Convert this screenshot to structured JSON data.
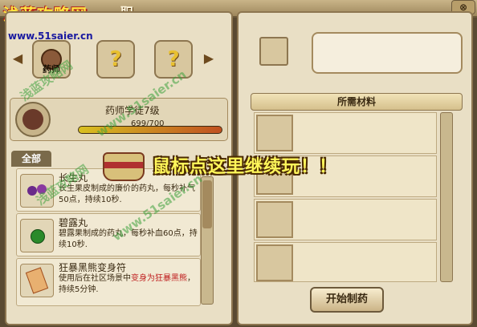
{
  "watermark": {
    "site": "浅蓝攻略网",
    "url": "www.51saier.cn",
    "diag_url": "www.51saier.cn",
    "diag_cn": "浅蓝攻略网"
  },
  "window": {
    "title": "职",
    "close_label": "⊗"
  },
  "recipes": {
    "prev_icon": "triangle-left-icon",
    "next_icon": "triangle-right-icon",
    "slots": [
      {
        "label": "药师",
        "icon": "pill-icon"
      },
      {
        "label": "?",
        "icon": "question-icon"
      },
      {
        "label": "?",
        "icon": "question-icon"
      }
    ]
  },
  "skill": {
    "name": "药师学徒7级",
    "exp_text": "699/700",
    "exp_fraction": 0.9986
  },
  "tabs": {
    "all": "全部"
  },
  "items": [
    {
      "name": "长生丸",
      "desc": "长生果皮制成的廉价的药丸，每秒补气50点，持续10秒."
    },
    {
      "name": "碧露丸",
      "desc": "碧露果制成的药丸，每秒补血60点，持续10秒."
    },
    {
      "name": "狂暴黑熊变身符",
      "desc_pre": "使用后在社区场景中",
      "desc_hl": "变身为狂暴黑熊",
      "desc_post": "，持续5分钟."
    }
  ],
  "materials": {
    "header": "所需材料",
    "rows": 4
  },
  "start_button": "开始制药",
  "overlay": "鼠标点这里继续玩！！",
  "colors": {
    "highlight": "#c02020",
    "overlay_text": "#fff65a",
    "watermark_title": "#ffe640"
  }
}
